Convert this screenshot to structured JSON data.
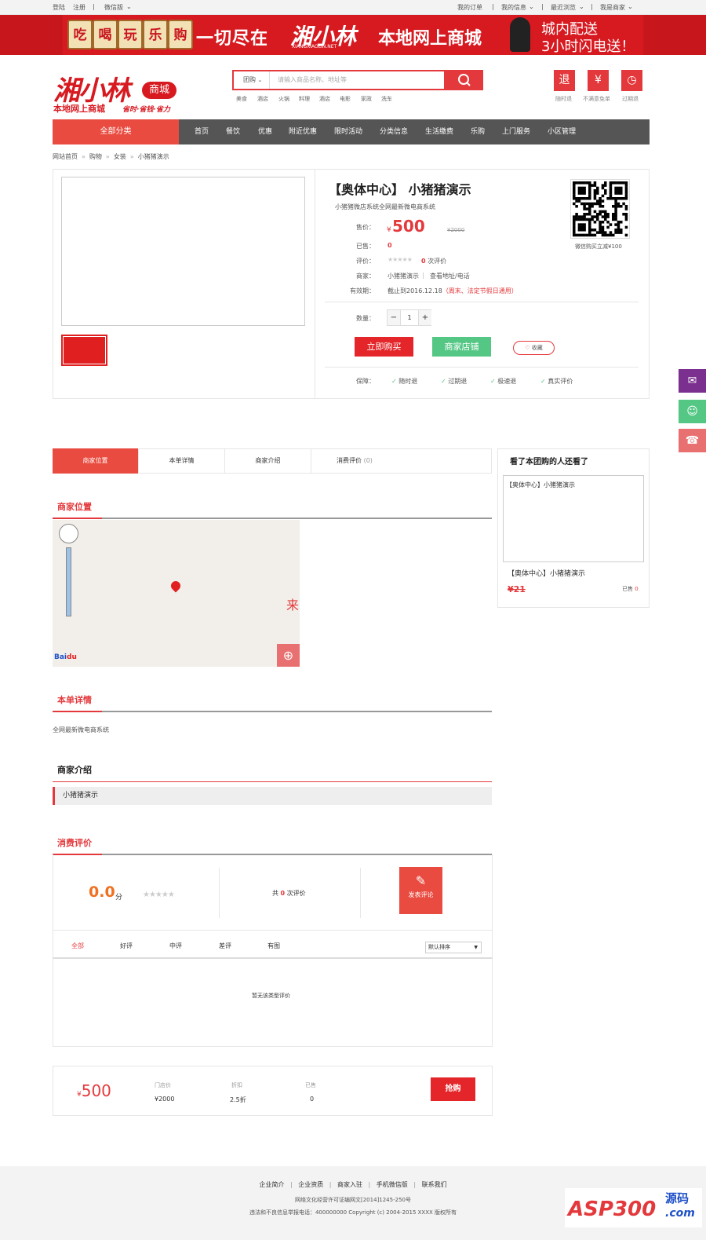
{
  "topbar": {
    "login": "登陆",
    "register": "注册",
    "wechat": "微信版",
    "orders": "我的订单",
    "myinfo": "我的信息",
    "recent": "最近浏览",
    "merchant": "我是商家"
  },
  "banner": {
    "tags": [
      "吃",
      "喝",
      "玩",
      "乐",
      "购"
    ],
    "text1": "一切尽在",
    "logo": "湘小林",
    "logo_sub": "XIANGXIAOLIN.NET",
    "text2": "本地网上商城",
    "right1": "城内配送",
    "right2": "3小时闪电送！"
  },
  "header": {
    "logo": "湘小林",
    "mall": "商城",
    "slogan1": "本地网上商城",
    "slogan2": "省时·省钱·省力",
    "search_select": "团购",
    "search_placeholder": "请输入商品名称、地址等",
    "hot": [
      "美食",
      "酒店",
      "火锅",
      "料理",
      "酒店",
      "电影",
      "家政",
      "洗车"
    ],
    "icons": [
      {
        "glyph": "退",
        "label": "随时退",
        "icon": "refund-icon"
      },
      {
        "glyph": "¥",
        "label": "不满意免单",
        "icon": "yen-icon"
      },
      {
        "glyph": "◷",
        "label": "过期退",
        "icon": "clock-icon"
      }
    ]
  },
  "nav": {
    "all": "全部分类",
    "items": [
      "首页",
      "餐饮",
      "优惠",
      "附近优惠",
      "限时活动",
      "分类信息",
      "生活缴费",
      "乐购",
      "上门服务",
      "小区管理"
    ]
  },
  "breadcrumb": [
    "网站首页",
    "购物",
    "女装",
    "小猪猪演示"
  ],
  "product": {
    "title": "【奥体中心】 小猪猪演示",
    "subtitle": "小猪猪微店系统全网最新微电商系统",
    "price_label": "售价：",
    "price_symbol": "¥",
    "price": "500",
    "original_price": "¥2000",
    "sold_label": "已售：",
    "sold": "0",
    "rating_label": "评价：",
    "rating_count": "0",
    "rating_suffix": "次评价",
    "merchant_label": "商家：",
    "merchant": "小猪猪演示",
    "merchant_link": "查看地址/电话",
    "validity_label": "有效期：",
    "validity": "截止到2016.12.18",
    "validity_note": "（周末、法定节假日通用）",
    "qty_label": "数量：",
    "qty": "1",
    "buy_now": "立即购买",
    "shop": "商家店铺",
    "favorite": "收藏",
    "guarantee_label": "保障：",
    "guarantees": [
      "随时退",
      "过期退",
      "极速退",
      "真实评价"
    ],
    "qr_caption": "微信购买立减¥100"
  },
  "tabs": [
    {
      "label": "商家位置",
      "count": ""
    },
    {
      "label": "本单详情",
      "count": ""
    },
    {
      "label": "商家介绍",
      "count": ""
    },
    {
      "label": "消费评价",
      "count": "(0)"
    }
  ],
  "sections": {
    "location": "商家位置",
    "map_text": "来",
    "detail": "本单详情",
    "detail_text": "全网最新微电商系统",
    "intro": "商家介绍",
    "intro_name": "小猪猪演示",
    "reviews": "消费评价"
  },
  "reviews": {
    "score": "0.0",
    "unit": "分",
    "count_prefix": "共",
    "count": "0",
    "count_suffix": "次评价",
    "post": "发表评论",
    "filters": [
      "全部",
      "好评",
      "中评",
      "差评",
      "有图"
    ],
    "sort": "默认排序",
    "empty": "暂无该类型评价"
  },
  "buybar": {
    "symbol": "¥",
    "price": "500",
    "store_price_label": "门店价",
    "store_price": "¥2000",
    "discount_label": "折扣",
    "discount": "2.5折",
    "sold_label": "已售",
    "sold": "0",
    "button": "抢购"
  },
  "sidebar": {
    "title": "看了本团购的人还看了",
    "img_alt": "【奥体中心】小猪猪演示",
    "name": "【奥体中心】小猪猪演示",
    "price": "¥21",
    "sold_label": "已售",
    "sold": "0"
  },
  "footer": {
    "links": [
      "企业简介",
      "企业资质",
      "商家入驻",
      "手机微信版",
      "联系我们"
    ],
    "line1": "网络文化经营许可证编网文[2014]1245-250号",
    "line2": "违法和不良信息举报电话：400000000 Copyright (c) 2004-2015 XXXX 版权所有",
    "watermark": "ASP300",
    "watermark_cn": "源码",
    "watermark_com": ".com"
  },
  "colors": {
    "accent": "#e4393c",
    "nav_bg": "#555555",
    "tab_active": "#e94b40",
    "shop_green": "#54c785"
  }
}
